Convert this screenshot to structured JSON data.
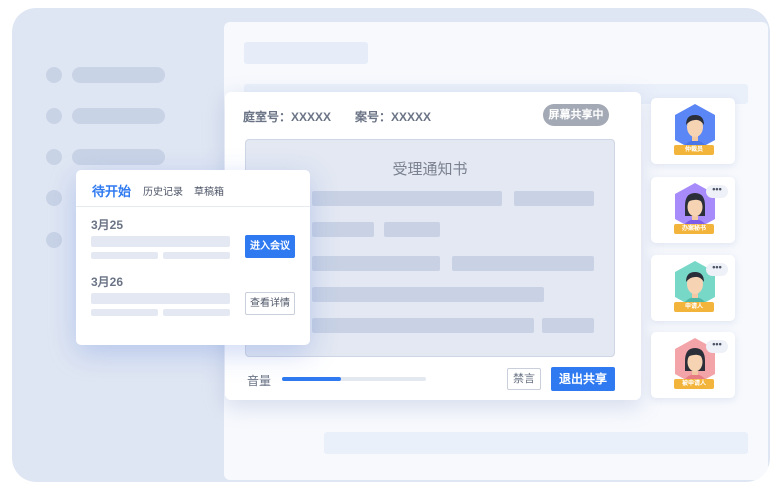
{
  "meeting": {
    "room_label": "庭室号：XXXXX",
    "case_label": "案号：XXXXX",
    "share_badge": "屏幕共享中",
    "document_title": "受理通知书",
    "volume_label": "音量",
    "volume_level": 0.41,
    "mute_label": "禁言",
    "exit_share_label": "退出共享"
  },
  "participants": [
    {
      "role": "仲裁员",
      "hex_color": "#5b86f5",
      "shirt_color": "#4a76e8",
      "speaking": false
    },
    {
      "role": "办案秘书",
      "hex_color": "#a78bfa",
      "shirt_color": "#7c5ce8",
      "speaking": true
    },
    {
      "role": "申请人",
      "hex_color": "#78d8c8",
      "shirt_color": "#4fb7a6",
      "speaking": true
    },
    {
      "role": "被申请人",
      "hex_color": "#f3a4a8",
      "shirt_color": "#e77d83",
      "speaking": true
    }
  ],
  "speaking_indicator": "•••",
  "schedule": {
    "tabs": [
      {
        "label": "待开始",
        "active": true
      },
      {
        "label": "历史记录",
        "active": false
      },
      {
        "label": "草稿箱",
        "active": false
      }
    ],
    "items": [
      {
        "date": "3月25",
        "action": "进入会议"
      },
      {
        "date": "3月26",
        "action": "查看详情"
      }
    ]
  },
  "colors": {
    "accent": "#2f7af0",
    "badge_gray": "#a3a9b5",
    "role_tag": "#f3b43b",
    "frame_bg": "#dfe6f3"
  }
}
